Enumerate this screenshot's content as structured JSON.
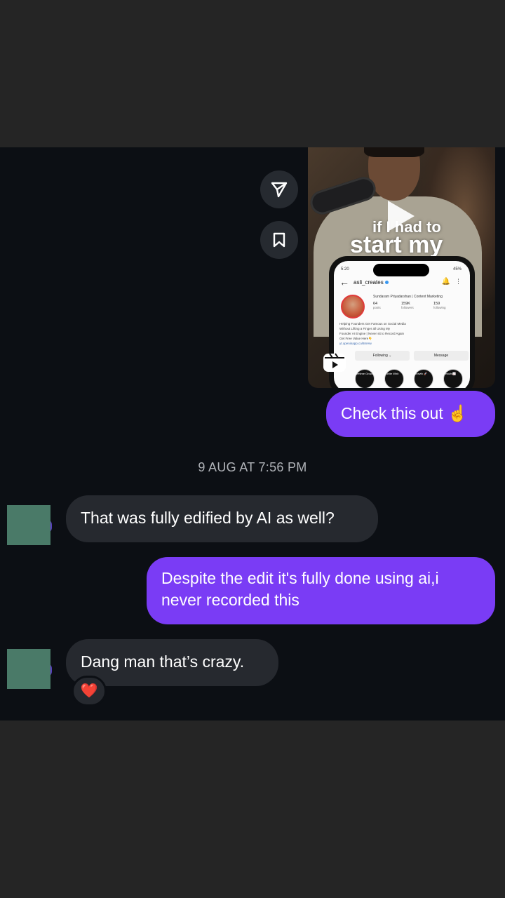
{
  "reel": {
    "overlay_line1": "if I had to",
    "overlay_line2": "start my",
    "profile": {
      "time": "5:20",
      "battery": "45%",
      "username": "asli_creates",
      "display_name": "Sundaram Priyadarshan | Content Marketing",
      "posts_count": "64",
      "posts_label": "posts",
      "followers_count": "159K",
      "followers_label": "followers",
      "following_count": "159",
      "following_label": "following",
      "bio_line1": "Helping Founders Get Famous on Social Media",
      "bio_line2": "Without Lifting a Finger all Using My",
      "bio_line3": "Founder AI Engine | Never sit to Record Again",
      "bio_line4": "Get Free Value Here👇",
      "bio_link": "yt.openinapp.co/8mHw",
      "following_btn": "Following ⌄",
      "message_btn": "Message",
      "highlights": [
        "Lifetime Growth",
        "Ulinite Whit",
        "Growth 🚀",
        "Results📈"
      ]
    }
  },
  "messages": {
    "sent_1": "Check this out ☝️",
    "timestamp": "9 AUG AT 7:56 PM",
    "received_1": "That was fully edified by AI as well?",
    "sent_2": "Despite the edit it's fully done using ai,i never recorded this",
    "received_2": "Dang man that’s crazy.",
    "reaction": "❤️"
  },
  "colors": {
    "outgoing_bubble": "#7a3cf5",
    "incoming_bubble": "#26292f",
    "chat_background": "#0c0f14",
    "frame_background": "#252525"
  },
  "icons": {
    "share": "paper-plane-icon",
    "save": "bookmark-icon",
    "play": "play-icon",
    "reels": "reels-icon"
  }
}
